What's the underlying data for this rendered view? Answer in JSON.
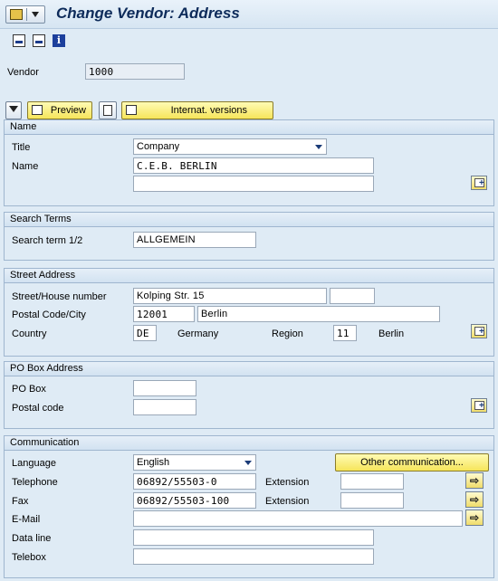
{
  "window": {
    "title": "Change Vendor: Address"
  },
  "header": {
    "vendor_label": "Vendor",
    "vendor_value": "1000"
  },
  "toolbar": {
    "preview_label": "Preview",
    "internat_label": "Internat. versions"
  },
  "name_group": {
    "title": "Name",
    "title_label": "Title",
    "title_value": "Company",
    "name_label": "Name",
    "name_value": "C.E.B. BERLIN",
    "name2_value": ""
  },
  "search_group": {
    "title": "Search Terms",
    "label": "Search term 1/2",
    "value": "ALLGEMEIN"
  },
  "street_group": {
    "title": "Street Address",
    "street_label": "Street/House number",
    "street_value": "Kolping Str. 15",
    "house_value": "",
    "postal_label": "Postal Code/City",
    "postal_value": "12001",
    "city_value": "Berlin",
    "country_label": "Country",
    "country_code": "DE",
    "country_name": "Germany",
    "region_label": "Region",
    "region_code": "11",
    "region_name": "Berlin"
  },
  "pobox_group": {
    "title": "PO Box Address",
    "pobox_label": "PO Box",
    "pobox_value": "",
    "postal_label": "Postal code",
    "postal_value": ""
  },
  "comm_group": {
    "title": "Communication",
    "language_label": "Language",
    "language_value": "English",
    "other_comm_label": "Other communication...",
    "telephone_label": "Telephone",
    "telephone_value": "06892/55503-0",
    "fax_label": "Fax",
    "fax_value": "06892/55503-100",
    "extension_label": "Extension",
    "tel_ext_value": "",
    "fax_ext_value": "",
    "email_label": "E-Mail",
    "email_value": "",
    "dataline_label": "Data line",
    "dataline_value": "",
    "telebox_label": "Telebox",
    "telebox_value": ""
  },
  "colors": {
    "background": "#dfebf5",
    "title": "#0d2b5a",
    "button_yellow": "#f6e55a"
  }
}
